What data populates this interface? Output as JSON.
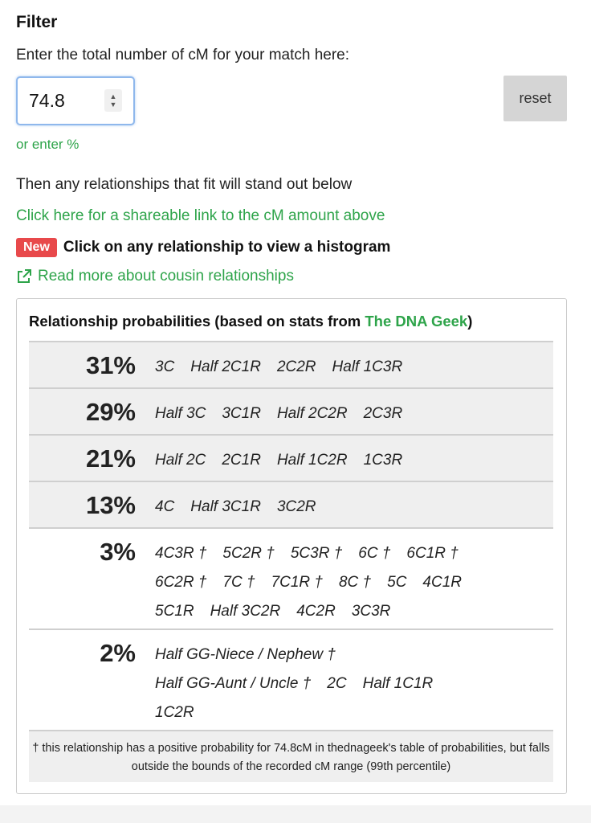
{
  "filter": {
    "title": "Filter",
    "prompt": "Enter the total number of cM for your match here:",
    "cm_value": "74.8",
    "reset_label": "reset",
    "or_enter_label": "or enter %"
  },
  "info": {
    "then_text": "Then any relationships that fit will stand out below",
    "share_link": "Click here for a shareable link to the cM amount above",
    "new_badge": "New",
    "new_text": "Click on any relationship to view a histogram",
    "read_more": "Read more about cousin relationships",
    "read_more_icon": "external-link-icon"
  },
  "panel": {
    "heading_prefix": "Relationship probabilities (based on stats from ",
    "heading_link": "The DNA Geek",
    "heading_suffix": ")",
    "rows": [
      {
        "pct": "31%",
        "rels": [
          "3C",
          "Half 2C1R",
          "2C2R",
          "Half 1C3R"
        ]
      },
      {
        "pct": "29%",
        "rels": [
          "Half 3C",
          "3C1R",
          "Half 2C2R",
          "2C3R"
        ]
      },
      {
        "pct": "21%",
        "rels": [
          "Half 2C",
          "2C1R",
          "Half 1C2R",
          "1C3R"
        ]
      },
      {
        "pct": "13%",
        "rels": [
          "4C",
          "Half 3C1R",
          "3C2R"
        ]
      },
      {
        "pct": "3%",
        "rels": [
          "4C3R †",
          "5C2R †",
          "5C3R †",
          "6C †",
          "6C1R †",
          "6C2R †",
          "7C †",
          "7C1R †",
          "8C †",
          "5C",
          "4C1R",
          "5C1R",
          "Half 3C2R",
          "4C2R",
          "3C3R"
        ]
      },
      {
        "pct": "2%",
        "rels": [
          "Half GG-Niece / Nephew †",
          "Half GG-Aunt / Uncle †",
          "2C",
          "Half 1C1R",
          "1C2R"
        ]
      }
    ],
    "footnote": "† this relationship has a positive probability for 74.8cM in thednageek's table of probabilities, but falls outside the bounds of the recorded cM range (99th percentile)"
  },
  "colors": {
    "link_green": "#2ea44a",
    "badge_red": "#e8494b",
    "row_shade": "#efefef",
    "reset_bg": "#d5d5d5"
  }
}
